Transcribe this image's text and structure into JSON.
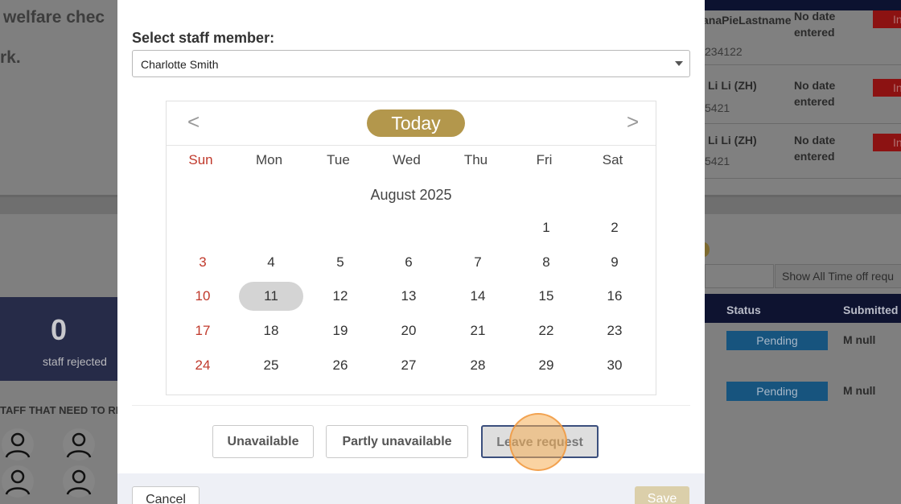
{
  "background": {
    "left_title_1": "welfare chec",
    "left_title_2": "rk.",
    "rejected_count": "0",
    "rejected_label": "staff rejected",
    "need_label": "TAFF THAT NEED TO RE",
    "right_rows": [
      {
        "name": "anaPieLastname",
        "date": "No date entered",
        "id": "234122",
        "flag": "In"
      },
      {
        "name": "Li Li (ZH)",
        "date": "No date entered",
        "id": "5421",
        "flag": "In"
      },
      {
        "name": "Li Li (ZH)",
        "date": "No date entered",
        "id": "5421",
        "flag": "In"
      }
    ],
    "filter_label": "Show All Time off requ",
    "table_headers": {
      "status": "Status",
      "submitted": "Submitted"
    },
    "table_rows": [
      {
        "status": "Pending",
        "submitted": "M null"
      },
      {
        "status": "Pending",
        "submitted": "M null"
      }
    ]
  },
  "modal": {
    "label": "Select staff member:",
    "selected_staff": "Charlotte Smith",
    "calendar": {
      "prev": "<",
      "next": ">",
      "today_label": "Today",
      "weekdays": [
        "Sun",
        "Mon",
        "Tue",
        "Wed",
        "Thu",
        "Fri",
        "Sat"
      ],
      "month_title": "August 2025",
      "weeks": [
        [
          "",
          "",
          "",
          "",
          "",
          "1",
          "2"
        ],
        [
          "3",
          "4",
          "5",
          "6",
          "7",
          "8",
          "9"
        ],
        [
          "10",
          "11",
          "12",
          "13",
          "14",
          "15",
          "16"
        ],
        [
          "17",
          "18",
          "19",
          "20",
          "21",
          "22",
          "23"
        ],
        [
          "24",
          "25",
          "26",
          "27",
          "28",
          "29",
          "30"
        ]
      ],
      "selected_day": "11"
    },
    "buttons": {
      "unavailable": "Unavailable",
      "partly": "Partly unavailable",
      "leave": "Leave request"
    },
    "footer": {
      "cancel": "Cancel",
      "save": "Save"
    }
  },
  "colors": {
    "accent_gold": "#b3974c",
    "sunday_red": "#c0392b",
    "selected_day_bg": "#d4d4d4",
    "active_button_border": "#3b4f7d"
  }
}
